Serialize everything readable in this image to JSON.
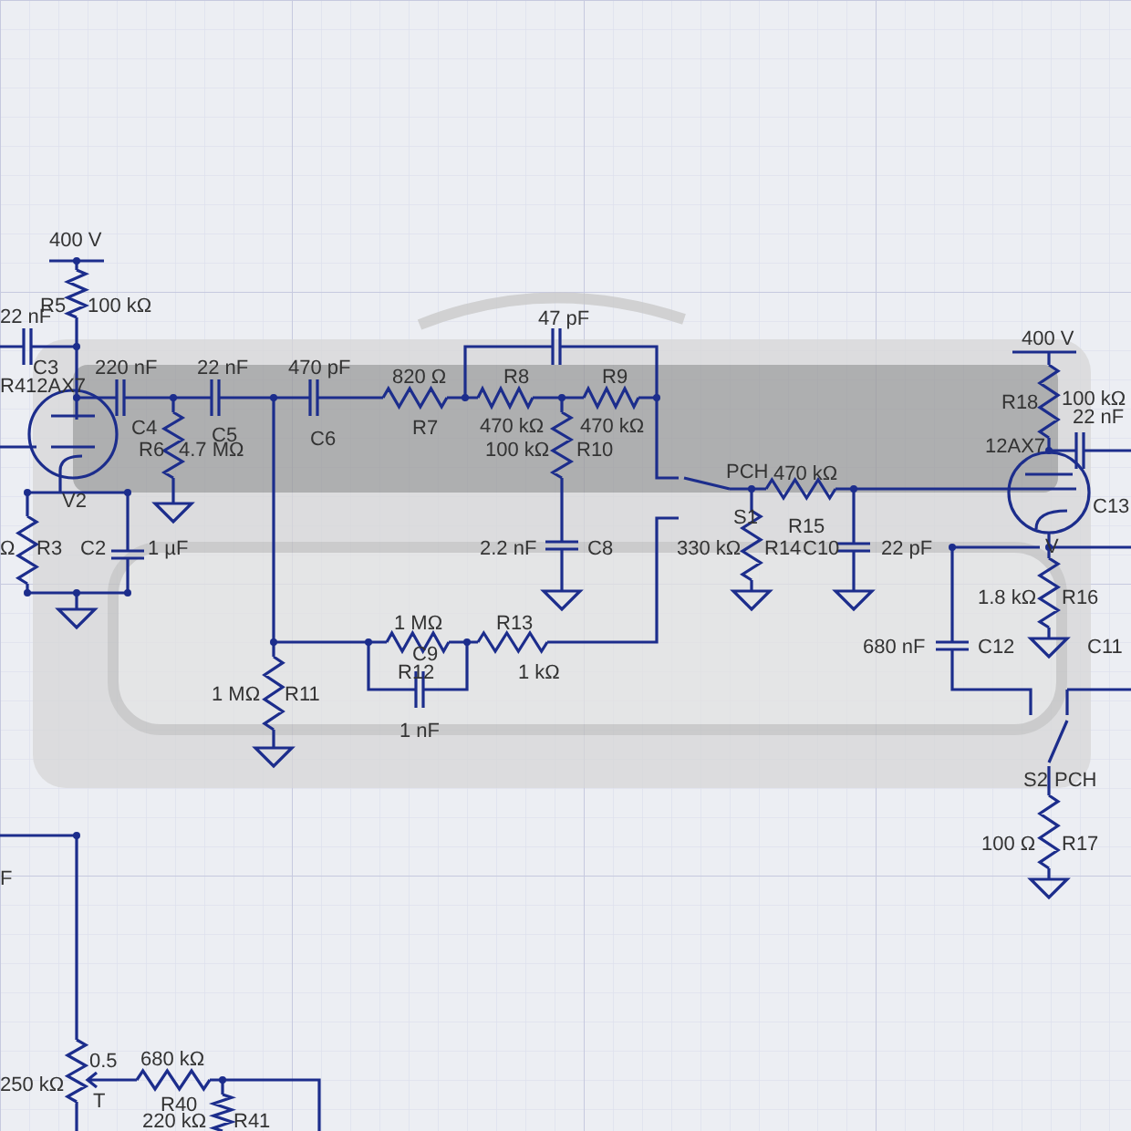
{
  "canvas": {
    "labels": [
      {
        "text": "400 V"
      },
      {
        "text": "R5"
      },
      {
        "text": "100 kΩ"
      },
      {
        "text": "22 nF"
      },
      {
        "text": "47 pF"
      },
      {
        "text": "400 V"
      },
      {
        "text": "220 nF"
      },
      {
        "text": "22 nF"
      },
      {
        "text": "470 pF"
      },
      {
        "text": "820 Ω"
      },
      {
        "text": "R8"
      },
      {
        "text": "R9"
      },
      {
        "text": "R18"
      },
      {
        "text": "100 kΩ"
      },
      {
        "text": "22 nF"
      },
      {
        "text": "C3"
      },
      {
        "text": "R4"
      },
      {
        "text": "12AX7"
      },
      {
        "text": "C4"
      },
      {
        "text": "C5"
      },
      {
        "text": "R6"
      },
      {
        "text": "4.7 MΩ"
      },
      {
        "text": "C6"
      },
      {
        "text": "R7"
      },
      {
        "text": "470 kΩ"
      },
      {
        "text": "470 kΩ"
      },
      {
        "text": "100 kΩ"
      },
      {
        "text": "R10"
      },
      {
        "text": "12AX7"
      },
      {
        "text": "PCH"
      },
      {
        "text": "470 kΩ"
      },
      {
        "text": "C13"
      },
      {
        "text": "V2"
      },
      {
        "text": "S1"
      },
      {
        "text": "R15"
      },
      {
        "text": "Ω"
      },
      {
        "text": "R3"
      },
      {
        "text": "C2"
      },
      {
        "text": "1 µF"
      },
      {
        "text": "2.2 nF"
      },
      {
        "text": "C8"
      },
      {
        "text": "330 kΩ"
      },
      {
        "text": "R14"
      },
      {
        "text": "C10"
      },
      {
        "text": "22 pF"
      },
      {
        "text": "V"
      },
      {
        "text": "1.8 kΩ"
      },
      {
        "text": "R16"
      },
      {
        "text": "1 MΩ"
      },
      {
        "text": "R13"
      },
      {
        "text": "680 nF"
      },
      {
        "text": "C12"
      },
      {
        "text": "C11"
      },
      {
        "text": "C9"
      },
      {
        "text": "R12"
      },
      {
        "text": "1 kΩ"
      },
      {
        "text": "1 MΩ"
      },
      {
        "text": "R11"
      },
      {
        "text": "1 nF"
      },
      {
        "text": "S2"
      },
      {
        "text": "PCH"
      },
      {
        "text": "100 Ω"
      },
      {
        "text": "R17"
      },
      {
        "text": "F"
      },
      {
        "text": "0.5"
      },
      {
        "text": "680 kΩ"
      },
      {
        "text": "250 kΩ"
      },
      {
        "text": "T"
      },
      {
        "text": "R40"
      },
      {
        "text": "220 kΩ"
      },
      {
        "text": "R41"
      }
    ]
  }
}
